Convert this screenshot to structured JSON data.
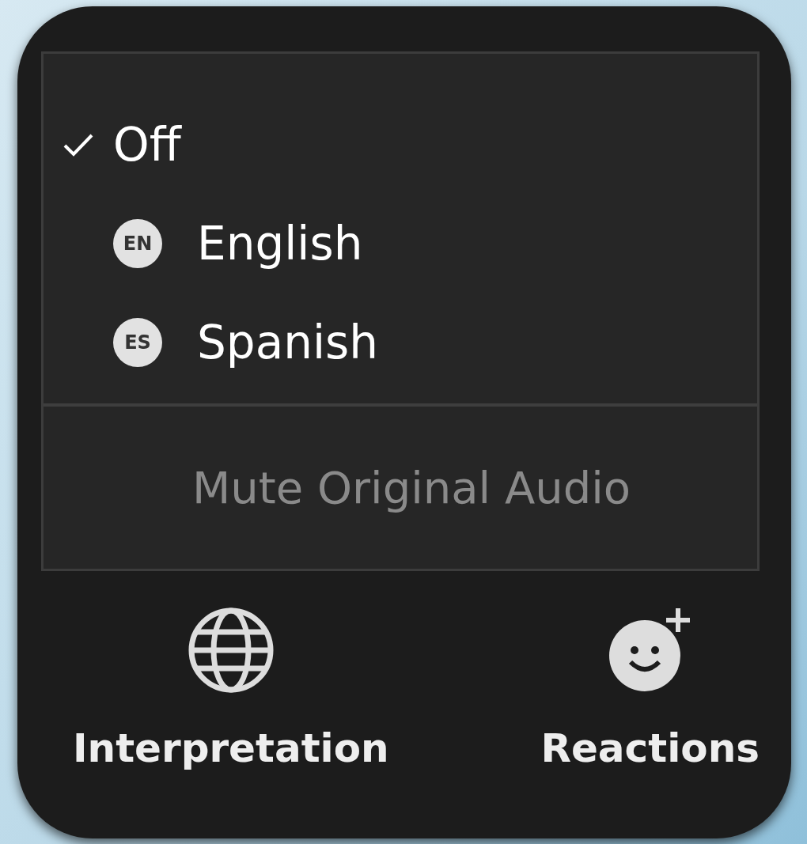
{
  "menu": {
    "items": [
      {
        "label": "Off",
        "checked": true
      },
      {
        "label": "English",
        "badge": "EN",
        "checked": false
      },
      {
        "label": "Spanish",
        "badge": "ES",
        "checked": false
      }
    ],
    "mute": {
      "label": "Mute Original Audio",
      "disabled": true
    }
  },
  "toolbar": [
    {
      "kind": "globe",
      "label": "Interpretation"
    },
    {
      "kind": "reaction",
      "label": "Reactions"
    }
  ]
}
